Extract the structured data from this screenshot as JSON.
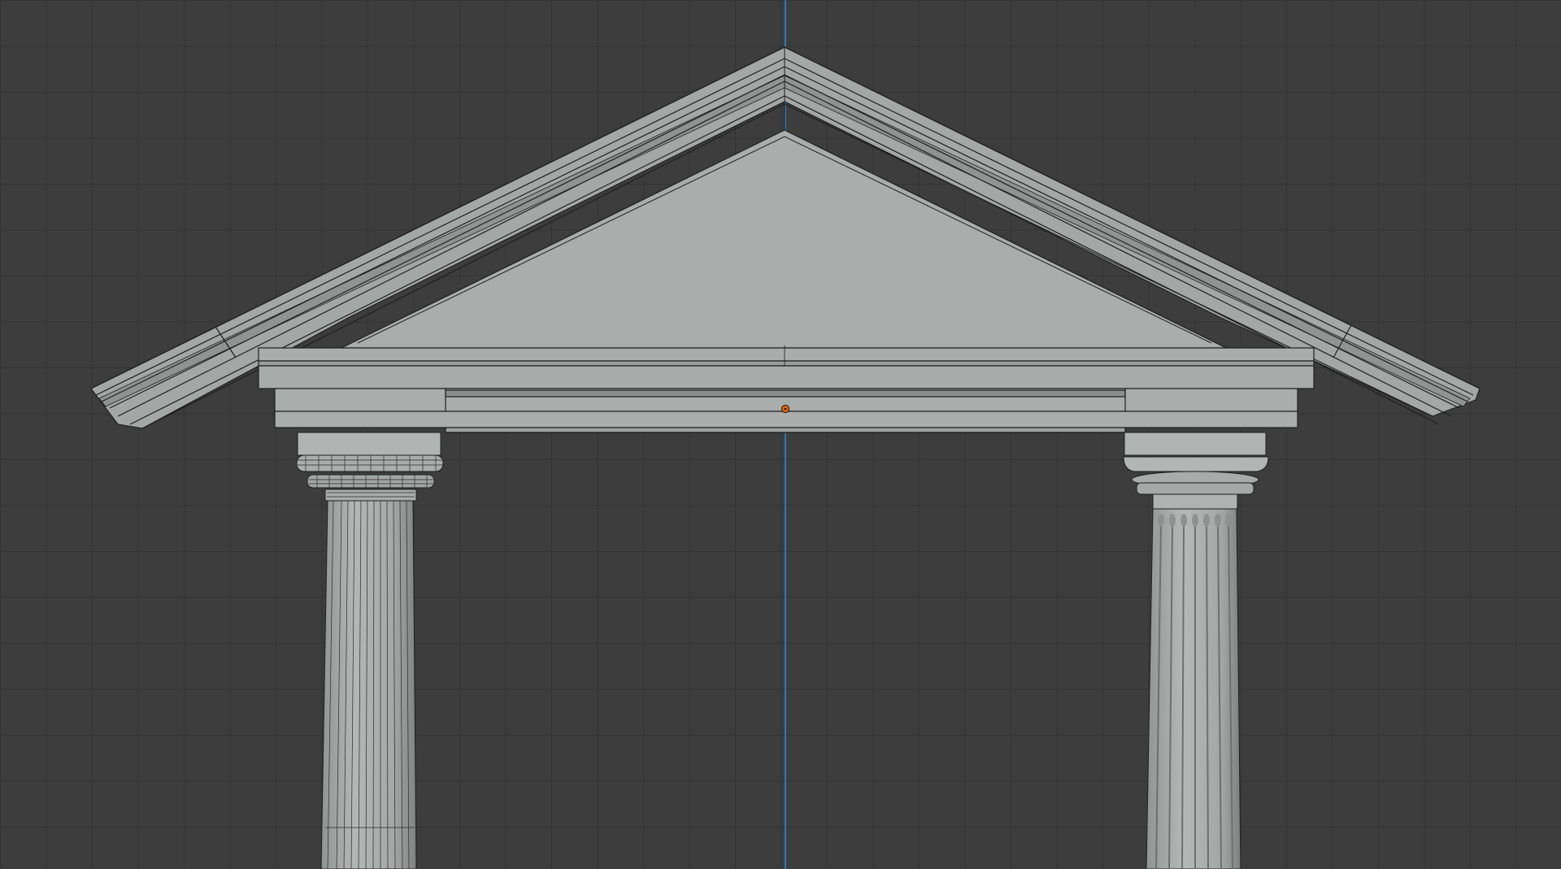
{
  "viewport": {
    "mode": "orthographic-front",
    "shading": "solid",
    "overlay": "wireframe",
    "grid": true,
    "colors": {
      "background": "#3d3d3d",
      "grid_line": "#333333",
      "z_axis": "#2f78b4",
      "geometry": "#a9adab",
      "geometry_shadow": "#8c908e",
      "edge": "#222222",
      "origin": "#e8711a"
    }
  },
  "scene": {
    "objects": [
      {
        "name": "pediment",
        "type": "mesh",
        "selected": false
      },
      {
        "name": "entablature",
        "type": "mesh",
        "selected": false
      },
      {
        "name": "column-left",
        "type": "mesh",
        "selected": false,
        "style": "wireframe-visible"
      },
      {
        "name": "column-right",
        "type": "mesh",
        "selected": false,
        "style": "fluted"
      }
    ],
    "origin_marker": {
      "icon": "object-origin-icon"
    }
  }
}
